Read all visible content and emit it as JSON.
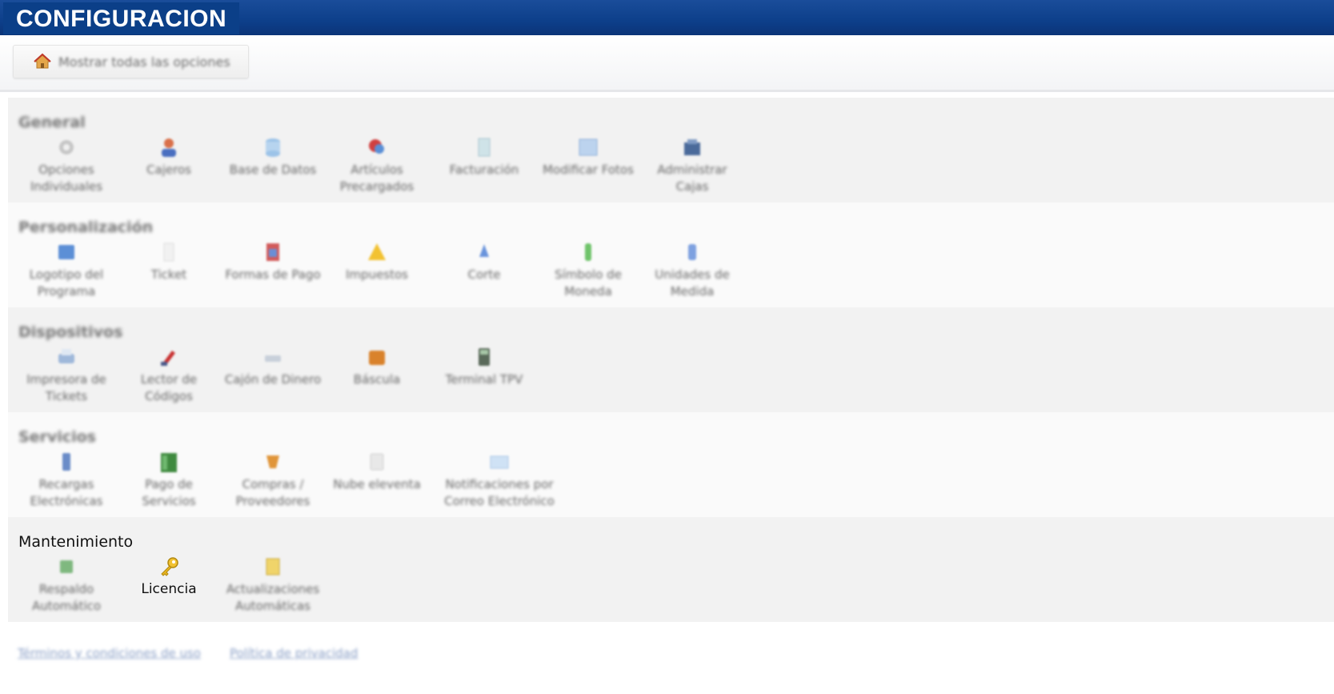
{
  "window": {
    "title": "CONFIGURACION"
  },
  "toolbar": {
    "show_all_label": "Mostrar todas las opciones"
  },
  "sections": [
    {
      "title": "General",
      "items": [
        {
          "label": "Opciones Individuales",
          "icon": "gear-icon"
        },
        {
          "label": "Cajeros",
          "icon": "user-icon"
        },
        {
          "label": "Base de Datos",
          "icon": "database-icon"
        },
        {
          "label": "Artículos Precargados",
          "icon": "products-icon"
        },
        {
          "label": "Facturación",
          "icon": "invoice-icon"
        },
        {
          "label": "Modificar Fotos",
          "icon": "photo-icon"
        },
        {
          "label": "Administrar Cajas",
          "icon": "register-icon"
        }
      ]
    },
    {
      "title": "Personalización",
      "items": [
        {
          "label": "Logotipo del Programa",
          "icon": "logo-icon"
        },
        {
          "label": "Ticket",
          "icon": "ticket-icon"
        },
        {
          "label": "Formas de Pago",
          "icon": "payment-icon"
        },
        {
          "label": "Impuestos",
          "icon": "tax-icon"
        },
        {
          "label": "Corte",
          "icon": "cut-icon"
        },
        {
          "label": "Símbolo de Moneda",
          "icon": "currency-icon"
        },
        {
          "label": "Unidades de Medida",
          "icon": "measure-icon"
        }
      ]
    },
    {
      "title": "Dispositivos",
      "items": [
        {
          "label": "Impresora de Tickets",
          "icon": "printer-icon"
        },
        {
          "label": "Lector de Códigos",
          "icon": "scanner-icon"
        },
        {
          "label": "Cajón de Dinero",
          "icon": "cash-drawer-icon"
        },
        {
          "label": "Báscula",
          "icon": "scale-icon"
        },
        {
          "label": "Terminal TPV",
          "icon": "pos-terminal-icon"
        }
      ]
    },
    {
      "title": "Servicios",
      "items": [
        {
          "label": "Recargas Electrónicas",
          "icon": "phone-icon"
        },
        {
          "label": "Pago de Servicios",
          "icon": "bill-icon"
        },
        {
          "label": "Compras / Proveedores",
          "icon": "shopping-icon"
        },
        {
          "label": "Nube eleventa",
          "icon": "cloud-icon"
        },
        {
          "label": "Notificaciones por Correo Electrónico",
          "icon": "mail-icon"
        }
      ]
    },
    {
      "title": "Mantenimiento",
      "items": [
        {
          "label": "Respaldo Automático",
          "icon": "backup-icon"
        },
        {
          "label": "Licencia",
          "icon": "key-icon"
        },
        {
          "label": "Actualizaciones Automáticas",
          "icon": "update-icon"
        }
      ]
    }
  ],
  "footer": {
    "terms_link": "Términos y condiciones de uso",
    "privacy_link": "Política de privacidad"
  }
}
